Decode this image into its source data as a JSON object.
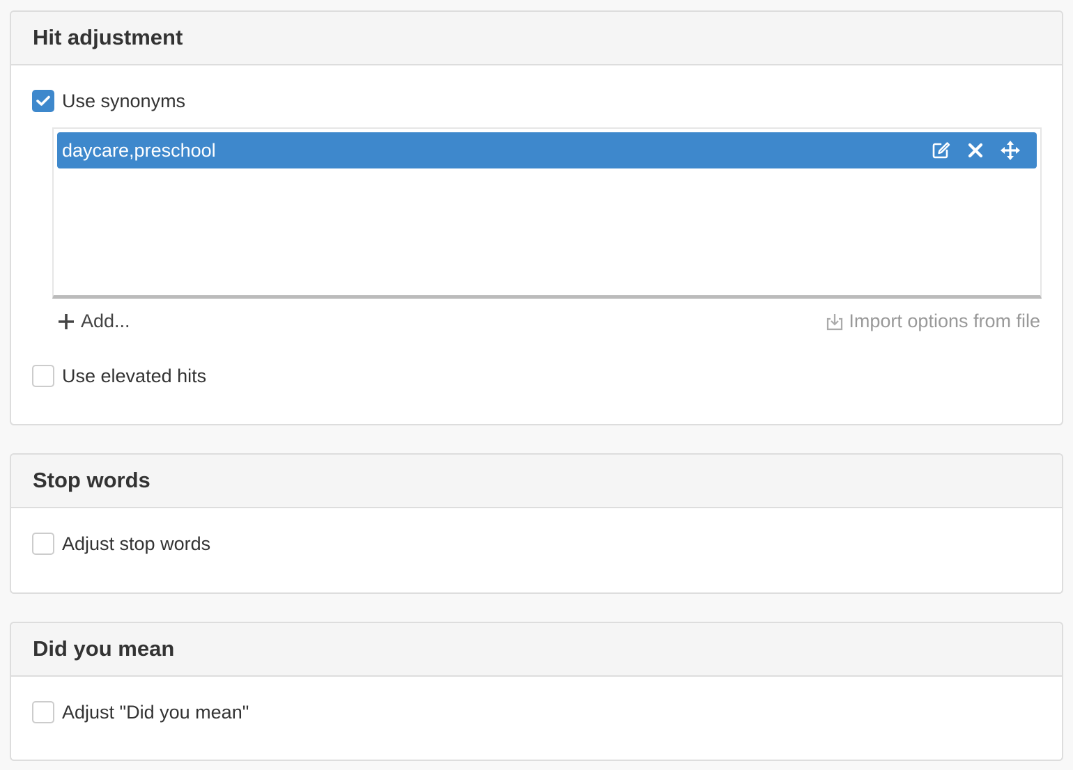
{
  "colors": {
    "accent": "#3e88cc",
    "panel_heading_bg": "#f5f5f5",
    "border": "#dddddd",
    "muted_text": "#999999"
  },
  "hit_adjustment": {
    "title": "Hit adjustment",
    "use_synonyms": {
      "label": "Use synonyms",
      "checked": true
    },
    "synonyms_list": {
      "items": [
        {
          "label": "daycare,preschool",
          "actions": [
            {
              "name": "edit",
              "icon": "edit-icon"
            },
            {
              "name": "remove",
              "icon": "close-icon"
            },
            {
              "name": "move",
              "icon": "move-icon"
            }
          ]
        }
      ]
    },
    "add_label": "Add...",
    "import_label": "Import options from file",
    "use_elevated_hits": {
      "label": "Use elevated hits",
      "checked": false
    }
  },
  "stop_words": {
    "title": "Stop words",
    "adjust_stop_words": {
      "label": "Adjust stop words",
      "checked": false
    }
  },
  "did_you_mean": {
    "title": "Did you mean",
    "adjust_did_you_mean": {
      "label": "Adjust \"Did you mean\"",
      "checked": false
    }
  }
}
